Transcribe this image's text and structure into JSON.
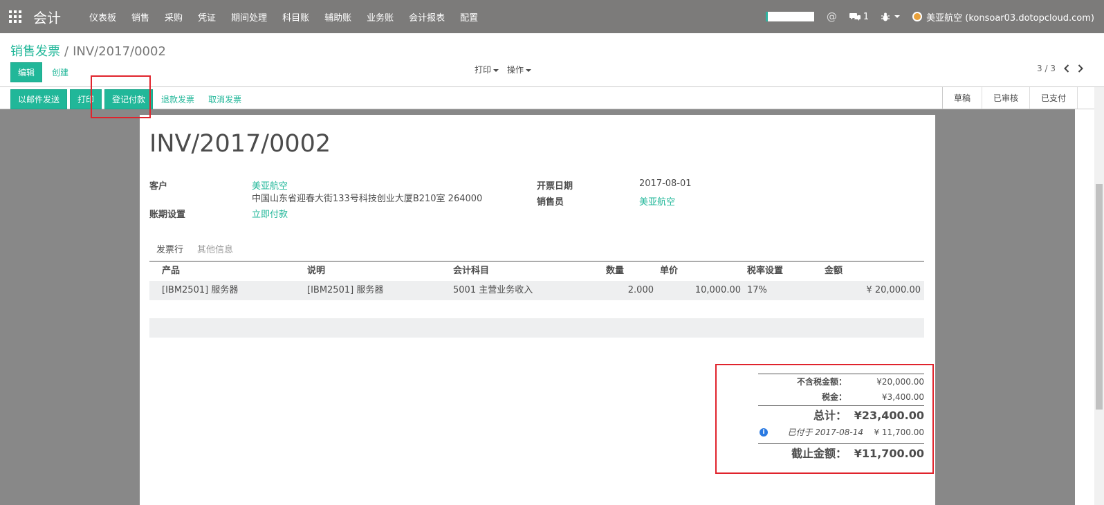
{
  "app": {
    "name": "会计",
    "menu": [
      "仪表板",
      "销售",
      "采购",
      "凭证",
      "期间处理",
      "科目账",
      "辅助账",
      "业务账",
      "会计报表",
      "配置"
    ],
    "message_count": "1",
    "user": "美亚航空 (konsoar03.dotopcloud.com)",
    "at_symbol": "@"
  },
  "breadcrumb": {
    "parent": "销售发票",
    "separator": "/",
    "current": "INV/2017/0002"
  },
  "control": {
    "edit": "编辑",
    "create": "创建",
    "print": "打印",
    "action": "操作",
    "pager": "3 / 3"
  },
  "status_buttons": {
    "send_email": "以邮件发送",
    "print": "打印",
    "register_payment": "登记付款",
    "refund": "退款发票",
    "cancel": "取消发票"
  },
  "stages": [
    "草稿",
    "已审核",
    "已支付"
  ],
  "invoice": {
    "number": "INV/2017/0002",
    "customer_label": "客户",
    "customer": "美亚航空",
    "customer_address": "中国山东省迎春大街133号科技创业大厦B210室 264000",
    "payment_term_label": "账期设置",
    "payment_term": "立即付款",
    "date_label": "开票日期",
    "date": "2017-08-01",
    "salesperson_label": "销售员",
    "salesperson": "美亚航空"
  },
  "tabs": [
    "发票行",
    "其他信息"
  ],
  "lines": {
    "headers": [
      "产品",
      "说明",
      "会计科目",
      "数量",
      "单价",
      "税率设置",
      "金额"
    ],
    "rows": [
      [
        "[IBM2501] 服务器",
        "[IBM2501] 服务器",
        "5001 主营业务收入",
        "2.000",
        "10,000.00",
        "17%",
        "¥ 20,000.00"
      ]
    ]
  },
  "totals": {
    "untaxed_label": "不含税金额：",
    "untaxed": "¥20,000.00",
    "tax_label": "税金：",
    "tax": "¥3,400.00",
    "total_label": "总计：",
    "total": "¥23,400.00",
    "paid_label": "已付于 2017-08-14",
    "paid": "¥ 11,700.00",
    "due_label": "截止金额：",
    "due": "¥11,700.00"
  },
  "colors": {
    "accent": "#21b799",
    "navbar": "#7c7b7a",
    "highlight": "#e0232c"
  }
}
